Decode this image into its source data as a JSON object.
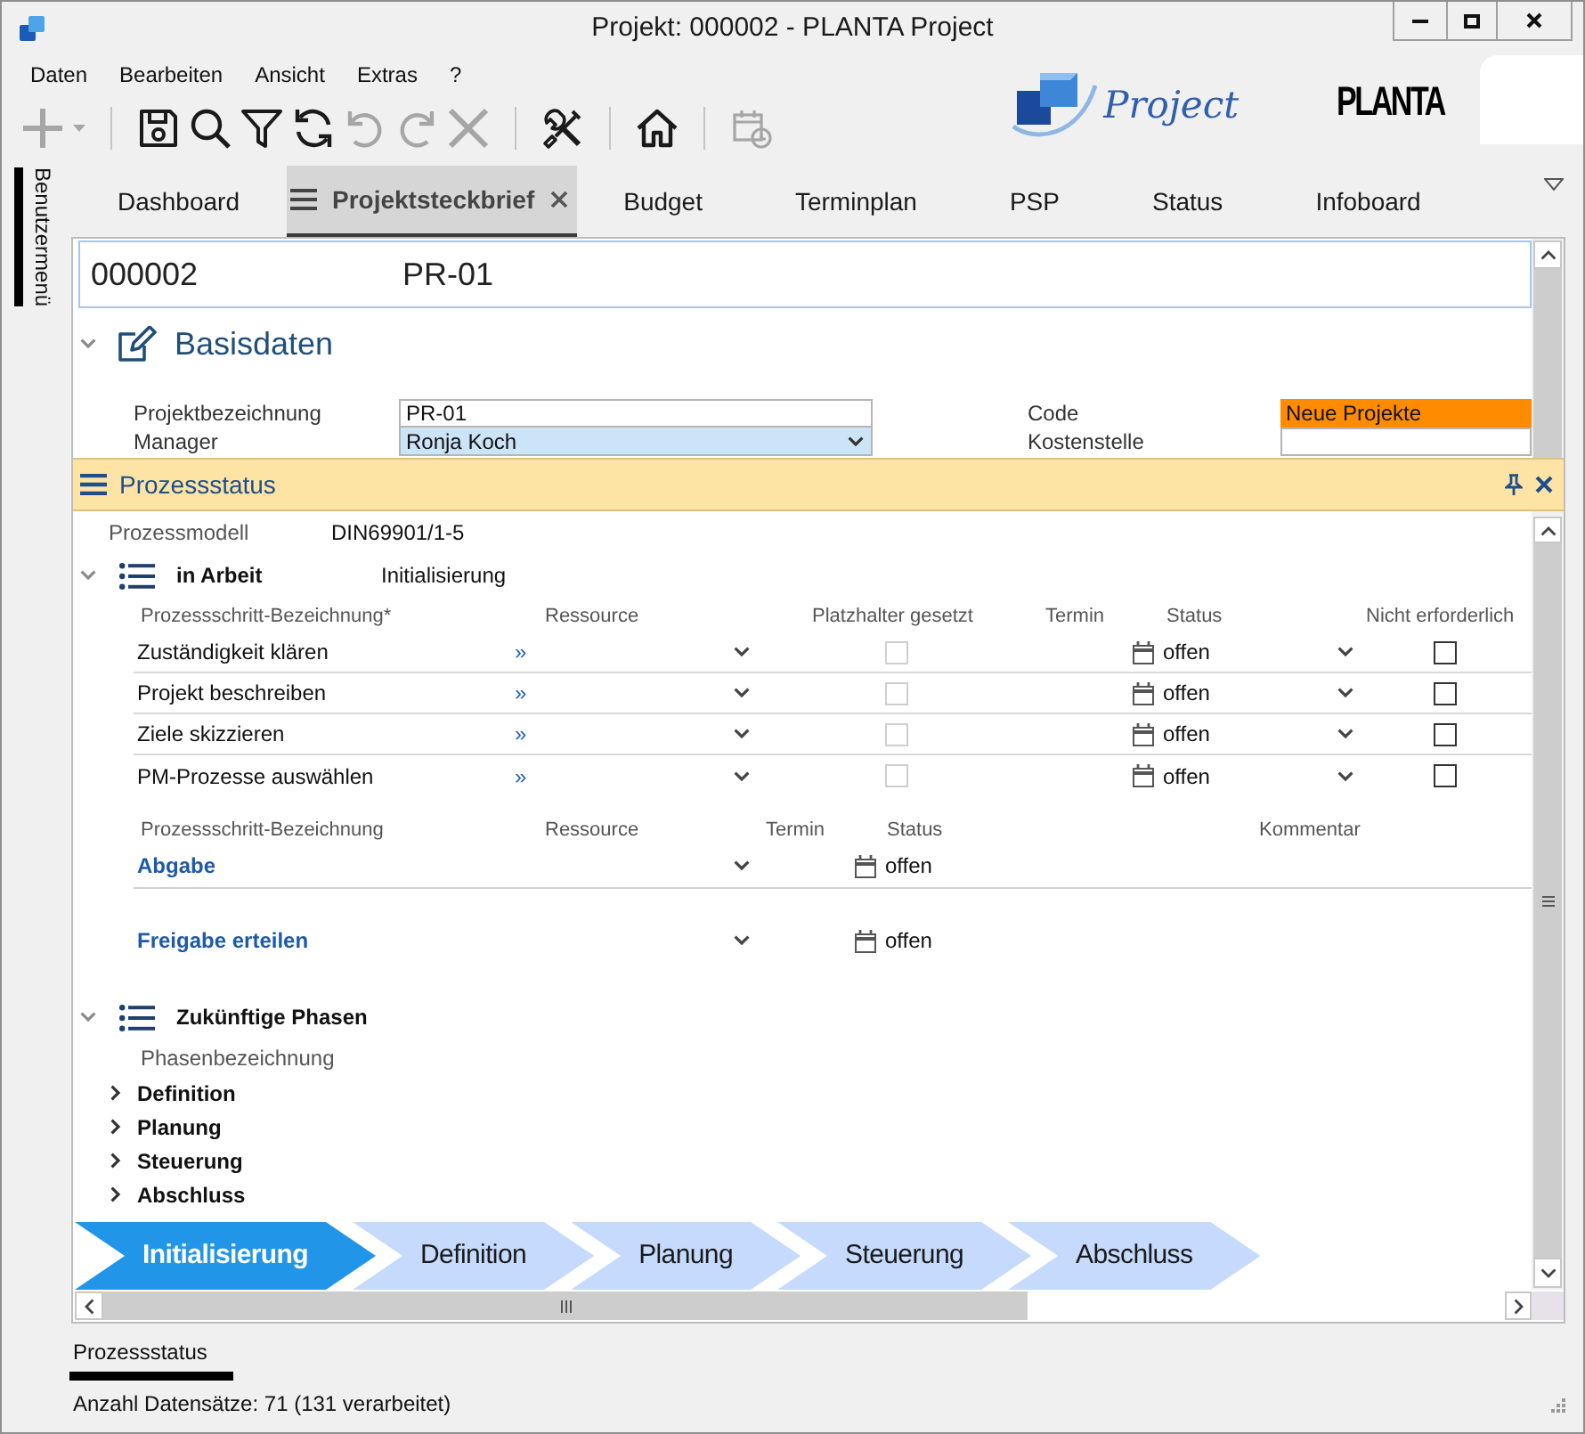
{
  "window": {
    "title": "Projekt: 000002 - PLANTA Project"
  },
  "menu": [
    "Daten",
    "Bearbeiten",
    "Ansicht",
    "Extras",
    "?"
  ],
  "toolbar": [
    [
      {
        "kind": "add",
        "disabled": true
      }
    ],
    [
      {
        "kind": "save",
        "disabled": false
      },
      {
        "kind": "search",
        "disabled": false
      },
      {
        "kind": "filter",
        "disabled": false
      },
      {
        "kind": "refresh",
        "disabled": false
      },
      {
        "kind": "undo",
        "disabled": true
      },
      {
        "kind": "redo",
        "disabled": true
      },
      {
        "kind": "delete",
        "disabled": true
      }
    ],
    [
      {
        "kind": "tools",
        "disabled": false
      }
    ],
    [
      {
        "kind": "home",
        "disabled": false
      }
    ],
    [
      {
        "kind": "schedule",
        "disabled": true
      }
    ]
  ],
  "logos": {
    "product": "Project",
    "brand": "PLANTA"
  },
  "side_tab": {
    "label": "Benutzermenü"
  },
  "tabs": [
    {
      "label": "Dashboard",
      "selected": false
    },
    {
      "label": "Projektsteckbrief",
      "selected": true
    },
    {
      "label": "Budget",
      "selected": false
    },
    {
      "label": "Terminplan",
      "selected": false
    },
    {
      "label": "PSP",
      "selected": false
    },
    {
      "label": "Status",
      "selected": false
    },
    {
      "label": "Infoboard",
      "selected": false
    }
  ],
  "project_header": {
    "number": "000002",
    "name": "PR-01"
  },
  "basisdaten": {
    "title": "Basisdaten",
    "expanded": true,
    "fields": [
      {
        "label": "Projektbezeichnung",
        "value": "PR-01",
        "kind": "text"
      },
      {
        "label": "Code",
        "value": "Neue Projekte",
        "kind": "flag"
      },
      {
        "label": "Manager",
        "value": "Ronja Koch",
        "kind": "select"
      },
      {
        "label": "Kostenstelle",
        "kind": "text"
      }
    ]
  },
  "panel": {
    "title": "Prozessstatus",
    "process_model": {
      "label": "Prozessmodell",
      "value": "DIN69901/1-5"
    },
    "current_phase": {
      "status": "in Arbeit",
      "name": "Initialisierung",
      "expanded": true,
      "steps": {
        "columns": [
          "Prozessschritt-Bezeichnung*",
          "Ressource",
          "Platzhalter gesetzt",
          "Termin",
          "Status",
          "Nicht erforderlich"
        ],
        "rows": [
          {
            "name": "Zuständigkeit klären",
            "resource_link": "»",
            "placeholder_set": false,
            "status": "offen",
            "not_required": false
          },
          {
            "name": "Projekt beschreiben",
            "resource_link": "»",
            "placeholder_set": false,
            "status": "offen",
            "not_required": false
          },
          {
            "name": "Ziele skizzieren",
            "resource_link": "»",
            "placeholder_set": false,
            "status": "offen",
            "not_required": false
          },
          {
            "name": "PM-Prozesse auswählen",
            "resource_link": "»",
            "placeholder_set": false,
            "status": "offen",
            "not_required": false
          }
        ]
      },
      "milestones": {
        "columns": [
          "Prozessschritt-Bezeichnung",
          "Ressource",
          "Termin",
          "Status",
          "Kommentar"
        ],
        "rows": [
          {
            "name": "Abgabe",
            "status": "offen"
          },
          {
            "name": "Freigabe erteilen",
            "status": "offen"
          }
        ]
      }
    },
    "future_phases": {
      "title": "Zukünftige Phasen",
      "expanded": true,
      "column": "Phasenbezeichnung",
      "phases": [
        {
          "name": "Definition",
          "expanded": false
        },
        {
          "name": "Planung",
          "expanded": false
        },
        {
          "name": "Steuerung",
          "expanded": false
        },
        {
          "name": "Abschluss",
          "expanded": false
        }
      ]
    },
    "phase_bar": [
      {
        "label": "Initialisierung",
        "selected": true
      },
      {
        "label": "Definition",
        "selected": false
      },
      {
        "label": "Planung",
        "selected": false
      },
      {
        "label": "Steuerung",
        "selected": false
      },
      {
        "label": "Abschluss",
        "selected": false
      }
    ]
  },
  "bottom_tabs": [
    {
      "label": "Prozessstatus",
      "selected": true
    }
  ],
  "status_bar": {
    "record_count": "Anzahl Datensätze: 71 (131 verarbeitet)"
  }
}
